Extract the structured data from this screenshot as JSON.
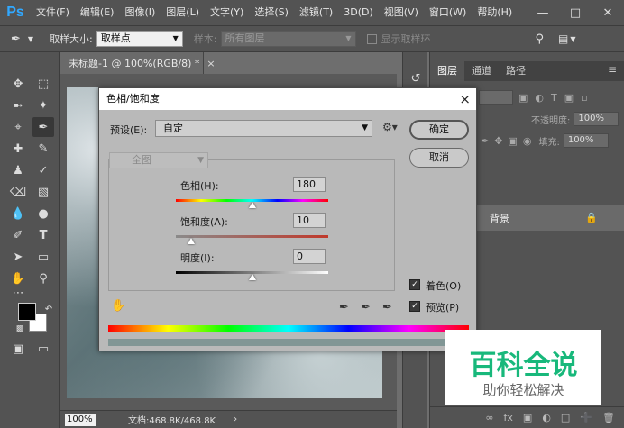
{
  "app": {
    "logo": "Ps"
  },
  "menubar": {
    "items": [
      "文件(F)",
      "编辑(E)",
      "图像(I)",
      "图层(L)",
      "文字(Y)",
      "选择(S)",
      "滤镜(T)",
      "3D(D)",
      "视图(V)",
      "窗口(W)",
      "帮助(H)"
    ],
    "window_controls": [
      "minimize-icon",
      "maximize-icon",
      "close-icon"
    ]
  },
  "options_bar": {
    "sample_size_label": "取样大小:",
    "sample_size_value": "取样点",
    "sample_label": "样本:",
    "sample_value": "所有图层",
    "show_ring_label": "显示取样环"
  },
  "document": {
    "tab_title": "未标题-1 @ 100%(RGB/8) *",
    "tab_close": "×",
    "zoom": "100%",
    "doc_info": "文档:468.8K/468.8K",
    "status_arrow": "›"
  },
  "layers_panel": {
    "tabs": [
      "图层",
      "通道",
      "路径"
    ],
    "opacity_label": "不透明度:",
    "opacity_value": "100%",
    "fill_label": "填充:",
    "fill_value": "100%",
    "layer_name": "背景"
  },
  "dialog": {
    "title": "色相/饱和度",
    "close": "×",
    "preset_label": "预设(E):",
    "preset_value": "自定",
    "ok_label": "确定",
    "cancel_label": "取消",
    "channel_value": "全图",
    "hue_label": "色相(H):",
    "hue_value": "180",
    "saturation_label": "饱和度(A):",
    "saturation_value": "10",
    "lightness_label": "明度(I):",
    "lightness_value": "0",
    "colorize_label": "着色(O)",
    "colorize_checked": true,
    "preview_label": "预览(P)",
    "preview_checked": true,
    "hue_slider_fraction": 0.5,
    "saturation_slider_fraction": 0.1,
    "lightness_slider_fraction": 0.5,
    "result_color": "#819695"
  },
  "watermark": {
    "title": "百科全说",
    "subtitle": "助你轻松解决",
    "color": "#18b87b"
  }
}
